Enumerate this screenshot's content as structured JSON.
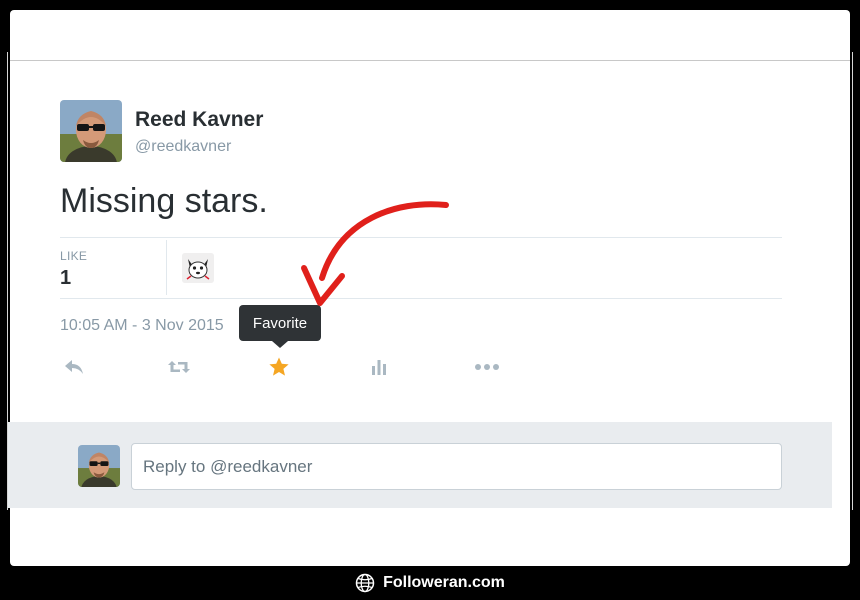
{
  "tweet": {
    "author_name": "Reed Kavner",
    "author_handle": "@reedkavner",
    "text": "Missing stars.",
    "like_label": "LIKE",
    "like_count": "1",
    "timestamp": "10:05 AM - 3 Nov 2015"
  },
  "tooltip": {
    "text": "Favorite"
  },
  "actions": [
    {
      "icon": "reply-icon"
    },
    {
      "icon": "retweet-icon"
    },
    {
      "icon": "star-icon",
      "color": "#f5a623"
    },
    {
      "icon": "analytics-icon"
    },
    {
      "icon": "more-icon"
    }
  ],
  "reply": {
    "placeholder": "Reply to @reedkavner"
  },
  "annotation": {
    "arrow_color": "#e0201b"
  },
  "footer": {
    "icon": "globe-icon",
    "text": "Followeran.com"
  }
}
